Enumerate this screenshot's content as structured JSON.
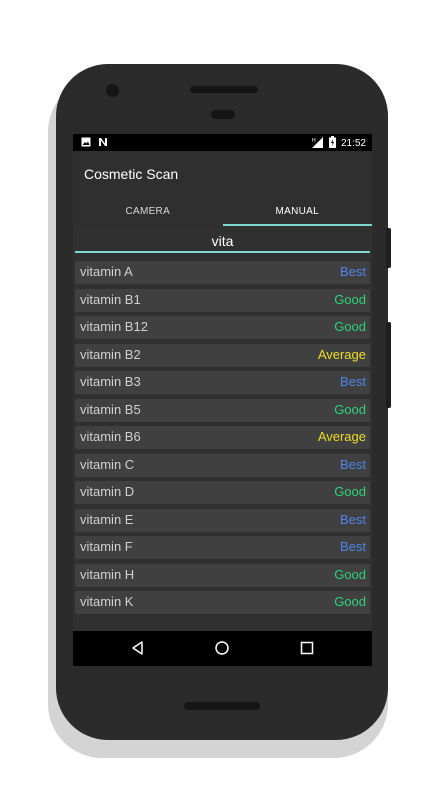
{
  "statusbar": {
    "left_icons": [
      "image-icon",
      "n-icon"
    ],
    "time": "21:52",
    "right_icons": [
      "signal-icon",
      "battery-icon"
    ]
  },
  "app": {
    "title": "Cosmetic Scan"
  },
  "tabs": [
    {
      "label": "CAMERA",
      "active": false
    },
    {
      "label": "MANUAL",
      "active": true
    }
  ],
  "search": {
    "value": "vita"
  },
  "colors": {
    "best": "#4f84e8",
    "good": "#2fd17a",
    "average": "#f0dc28",
    "accent": "#7fd7d0"
  },
  "results": [
    {
      "name": "vitamin A",
      "rating": "Best"
    },
    {
      "name": "vitamin B1",
      "rating": "Good"
    },
    {
      "name": "vitamin B12",
      "rating": "Good"
    },
    {
      "name": "vitamin B2",
      "rating": "Average"
    },
    {
      "name": "vitamin B3",
      "rating": "Best"
    },
    {
      "name": "vitamin B5",
      "rating": "Good"
    },
    {
      "name": "vitamin B6",
      "rating": "Average"
    },
    {
      "name": "vitamin C",
      "rating": "Best"
    },
    {
      "name": "vitamin D",
      "rating": "Good"
    },
    {
      "name": "vitamin E",
      "rating": "Best"
    },
    {
      "name": "vitamin F",
      "rating": "Best"
    },
    {
      "name": "vitamin H",
      "rating": "Good"
    },
    {
      "name": "vitamin K",
      "rating": "Good"
    }
  ],
  "navbar": {
    "buttons": [
      "back-icon",
      "home-icon",
      "recents-icon"
    ]
  }
}
